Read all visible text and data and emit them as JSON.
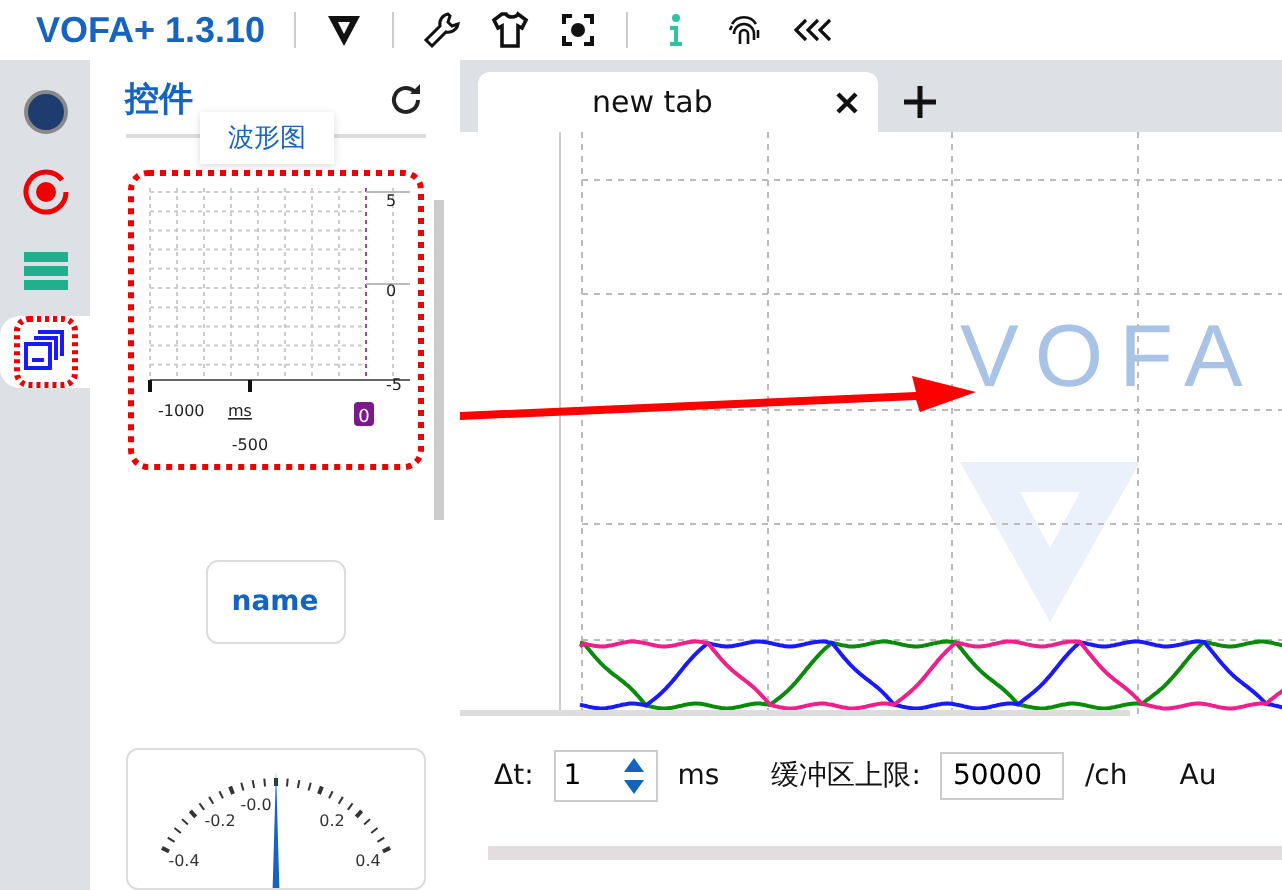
{
  "title_bar": {
    "app_title": "VOFA+ 1.3.10"
  },
  "rail": [
    {
      "selected": false
    },
    {
      "selected": false
    },
    {
      "selected": false
    },
    {
      "selected": true
    }
  ],
  "panel": {
    "title": "控件",
    "tooltip": "波形图",
    "waveform_widget": {
      "y_ticks": [
        "5",
        "0",
        "-5"
      ],
      "x_ticks": [
        "-1000",
        "-500"
      ],
      "unit": "ms",
      "badge": "0"
    },
    "button_widget": {
      "label": "name"
    },
    "gauge_widget": {
      "labels": [
        "-0.2",
        "-0.0",
        "0.2",
        "-0.4",
        "0.4"
      ]
    }
  },
  "tabs": [
    {
      "label": "new tab",
      "selected": true
    }
  ],
  "plot": {
    "logo_text": "VOFA"
  },
  "controls": {
    "dt_label": "Δt:",
    "dt_value": "1",
    "dt_unit": "ms",
    "buffer_label": "缓冲区上限:",
    "buffer_value": "50000",
    "buffer_unit": "/ch",
    "cut_label": "Au"
  }
}
